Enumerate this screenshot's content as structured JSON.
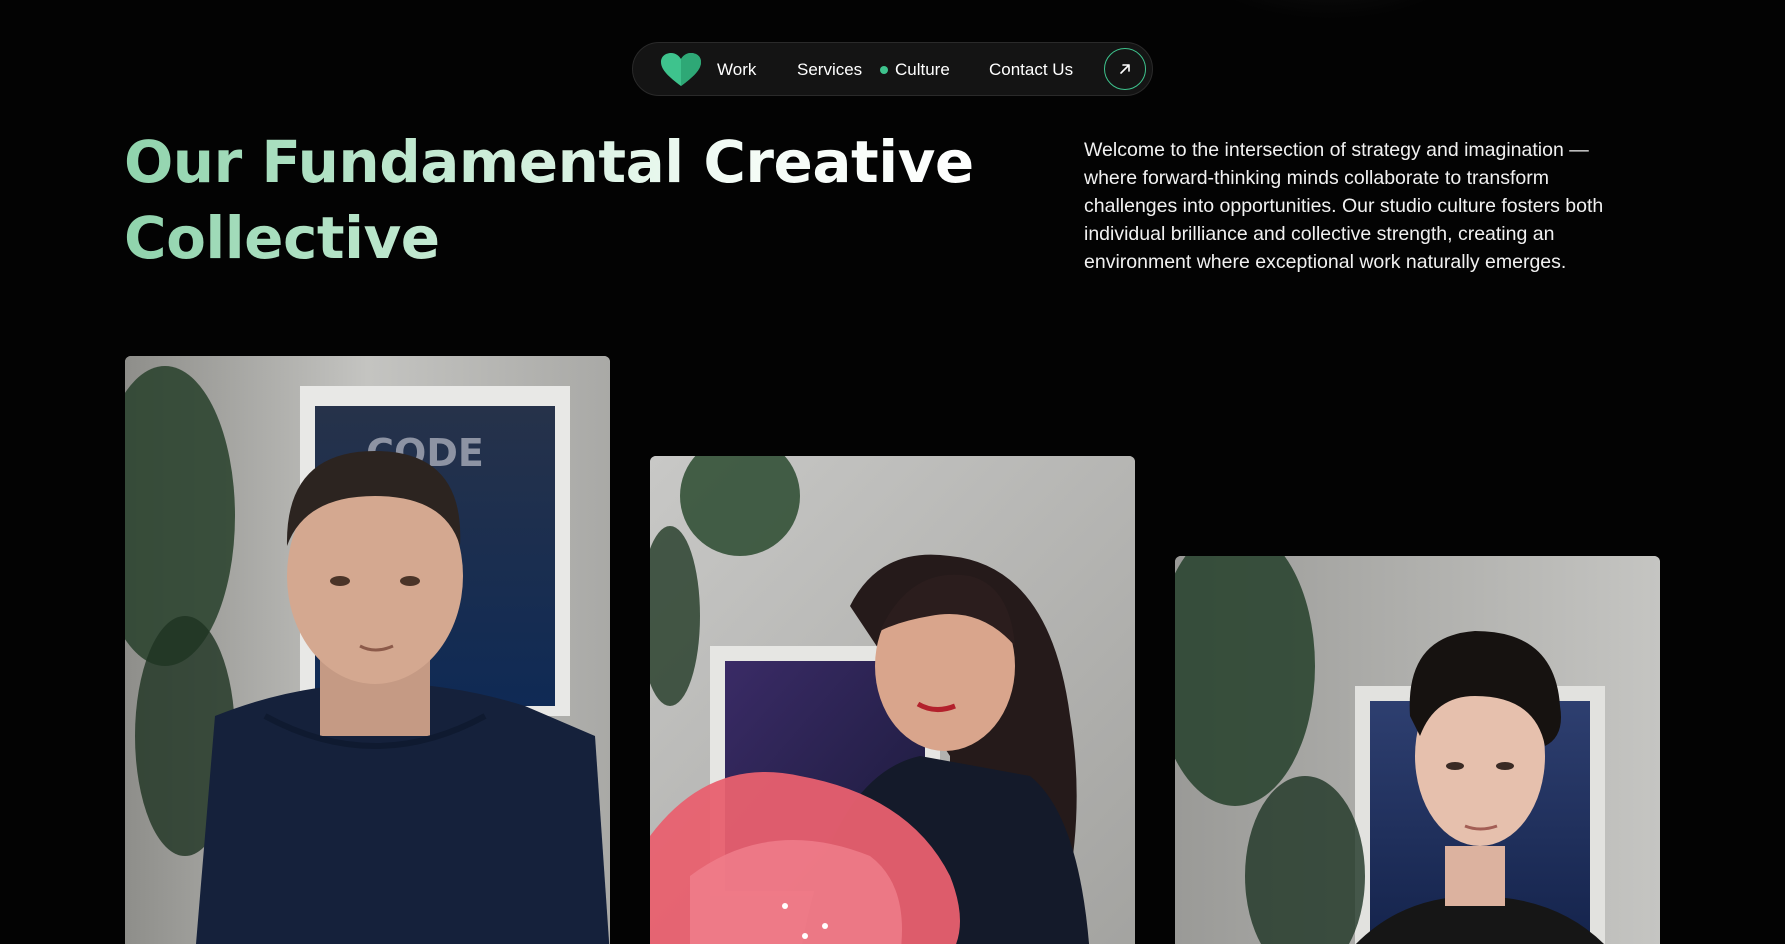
{
  "nav": {
    "logo_icon": "heart-icon",
    "items": [
      {
        "label": "Work"
      },
      {
        "label": "Services"
      },
      {
        "label": "Culture",
        "active": true
      },
      {
        "label": "Contact Us"
      }
    ],
    "cta_icon": "arrow-up-right-icon",
    "accent": "#3ec38d"
  },
  "hero": {
    "title_line1": "Our Fundamental Creative",
    "title_line2": "Collective",
    "intro": "Welcome to the intersection of strategy and imagination — where forward-thinking minds collaborate to transform challenges into opportunities. Our studio culture fosters both individual brilliance and collective strength, creating an environment where exceptional work naturally emerges."
  },
  "team_photos": [
    {
      "poster_text": "CODE"
    },
    {
      "poster_text": ""
    },
    {
      "poster_text": ""
    }
  ],
  "colors": {
    "background": "#030303",
    "title_gradient_start": "#8fd3ac",
    "title_gradient_end": "#ffffff"
  }
}
